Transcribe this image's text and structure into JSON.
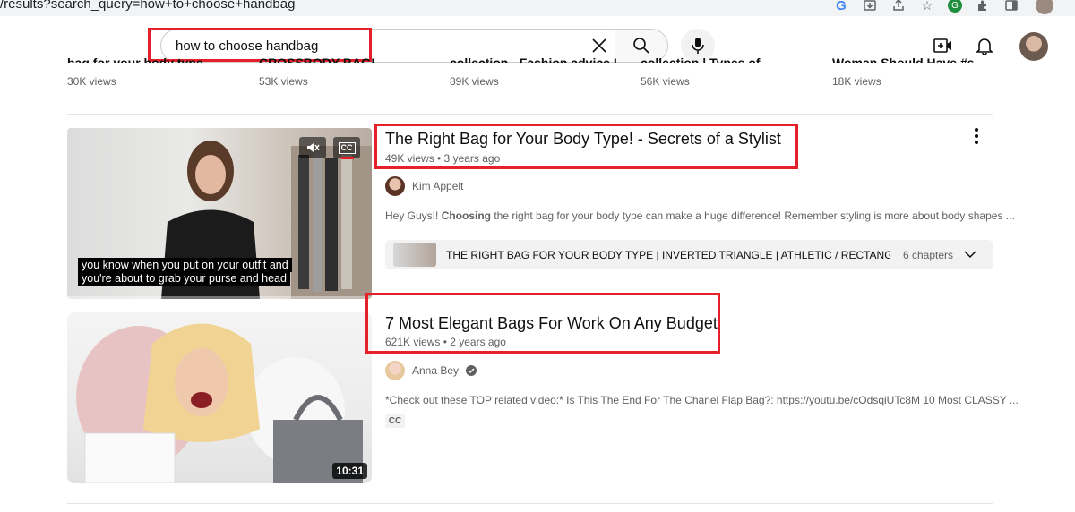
{
  "browser": {
    "url": "/results?search_query=how+to+choose+handbag",
    "icons": [
      "google-icon",
      "install-icon",
      "share-icon",
      "star-icon",
      "extension-grammarly-icon",
      "puzzle-icon",
      "sidepanel-icon",
      "profile-avatar"
    ]
  },
  "header": {
    "search_value": "how to choose handbag"
  },
  "shelf": [
    {
      "title": "bag for your body type...",
      "views": "30K views"
    },
    {
      "title": "CROSSBODY BAG!",
      "views": "53K views"
    },
    {
      "title": "collection - Fashion advice I...",
      "views": "89K views"
    },
    {
      "title": "collection | Types of...",
      "views": "56K views"
    },
    {
      "title": "Woman Should Have #shor",
      "views": "18K views"
    }
  ],
  "results": [
    {
      "title": "The Right Bag for Your Body Type! - Secrets of a Stylist",
      "meta": "49K views • 3 years ago",
      "channel": "Kim Appelt",
      "desc_prefix": "Hey Guys!! ",
      "desc_bold": "Choosing",
      "desc_rest": " the right bag for your body type can make a huge difference! Remember styling is more about body shapes ...",
      "subtitle_line1": "you know when you put on your outfit and",
      "subtitle_line2": "you're about to grab your purse and head",
      "cc_label": "CC",
      "chapters_text": "THE RIGHT BAG FOR YOUR BODY TYPE | INVERTED TRIANGLE | ATHLETIC / RECTANGLE | PEAR...",
      "chapters_count": "6 chapters"
    },
    {
      "title": "7 Most Elegant Bags For Work On Any Budget",
      "meta": "621K views • 2 years ago",
      "channel": "Anna Bey",
      "desc": "*Check out these TOP related video:* Is This The End For The Chanel Flap Bag?: https://youtu.be/cOdsqiUTc8M 10 Most CLASSY ...",
      "badge": "CC",
      "duration": "10:31"
    }
  ],
  "colors": {
    "highlight_red": "#e5202a",
    "text_primary": "#0f0f0f",
    "text_secondary": "#606060"
  }
}
